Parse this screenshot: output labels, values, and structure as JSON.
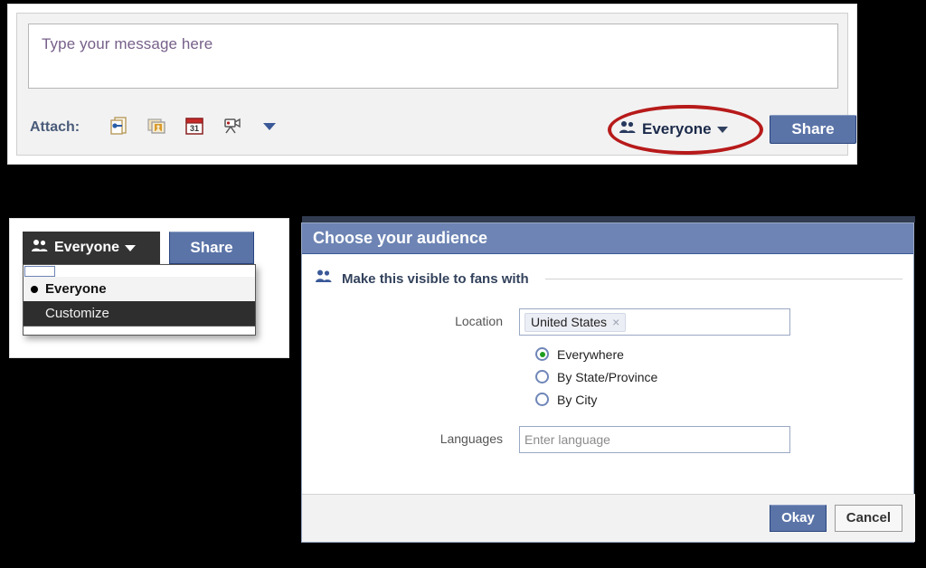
{
  "composer": {
    "message_placeholder": "Type your message here",
    "attach_label": "Attach:",
    "attach_icons": [
      {
        "name": "link-icon",
        "title": "Attach Link"
      },
      {
        "name": "photo-icon",
        "title": "Attach Photo"
      },
      {
        "name": "calendar-icon",
        "title": "Attach Event",
        "day": "31"
      },
      {
        "name": "video-icon",
        "title": "Attach Video"
      }
    ],
    "more_attach_icon": "chevron-down-icon",
    "audience_label": "Everyone",
    "audience_icon": "people-icon",
    "share_label": "Share",
    "highlight_color": "#b71a1a"
  },
  "dropdown_panel": {
    "audience_label": "Everyone",
    "audience_icon": "people-icon",
    "share_label": "Share",
    "menu_items": [
      {
        "label": "Everyone",
        "state": "selected"
      },
      {
        "label": "Customize",
        "state": "hovered"
      }
    ]
  },
  "dialog": {
    "title": "Choose your audience",
    "section_header": "Make this visible to fans with",
    "section_icon": "people-icon",
    "location_label": "Location",
    "location_tokens": [
      {
        "label": "United States",
        "remove": "×"
      }
    ],
    "location_options": [
      {
        "label": "Everywhere",
        "checked": true
      },
      {
        "label": "By State/Province",
        "checked": false
      },
      {
        "label": "By City",
        "checked": false
      }
    ],
    "languages_label": "Languages",
    "languages_placeholder": "Enter language",
    "languages_value": "",
    "okay_label": "Okay",
    "cancel_label": "Cancel",
    "titlebar_color": "#6d84b4",
    "primary_button_color": "#5b74a8"
  }
}
